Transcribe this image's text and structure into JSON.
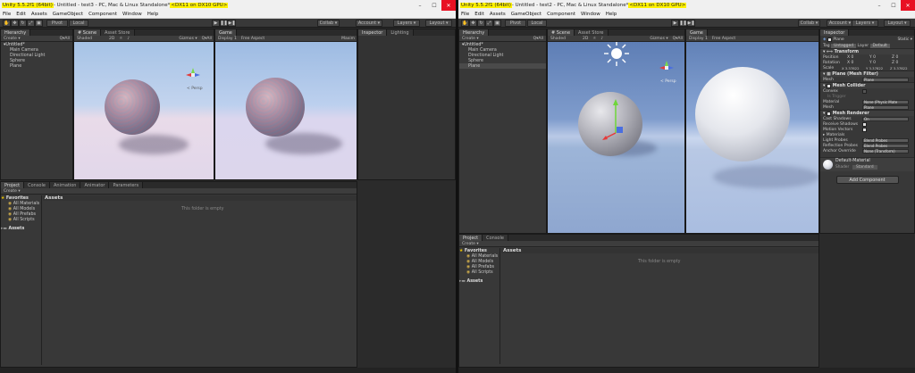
{
  "left": {
    "title_version": "Unity 5.5.2f1 (64bit)",
    "title_middle": " - Untitled - test3 - PC, Mac & Linux Standalone* ",
    "title_gpu": "<DX11 on DX10 GPU>",
    "menu": [
      "File",
      "Edit",
      "Assets",
      "GameObject",
      "Component",
      "Window",
      "Help"
    ],
    "toolbar": {
      "pivot": "Pivot",
      "local": "Local",
      "collab": "Collab ▾",
      "account": "Account ▾",
      "layers": "Layers ▾",
      "layout": "Layout ▾"
    },
    "hierarchy": {
      "tab": "Hierarchy",
      "create": "Create ▾",
      "search": "Q▾All",
      "root": "Untitled*",
      "items": [
        "Main Camera",
        "Directional Light",
        "Sphere",
        "Plane"
      ]
    },
    "scene": {
      "tab": "Scene",
      "tab2": "Asset Store",
      "shaded": "Shaded",
      "mode2d": "2D",
      "gizmos": "Gizmos ▾",
      "search": "Q▾All",
      "persp": "< Persp"
    },
    "game": {
      "tab": "Game",
      "display": "Display 1",
      "aspect": "Free Aspect",
      "maximize": "Maxim"
    },
    "inspector": {
      "tab": "Inspector",
      "tab2": "Lighting"
    },
    "project": {
      "tabs": [
        "Project",
        "Console",
        "Animation",
        "Animator",
        "Parameters"
      ],
      "create": "Create ▾",
      "favorites": "Favorites",
      "fav_items": [
        "All Materials",
        "All Models",
        "All Prefabs",
        "All Scripts"
      ],
      "assets": "Assets",
      "assets_header": "Assets",
      "empty": "This folder is empty"
    }
  },
  "right": {
    "title_version": "Unity 5.5.2f1 (64bit)",
    "title_middle": " - Untitled - test2 - PC, Mac & Linux Standalone* ",
    "title_gpu": "<DX11 on DX10 GPU>",
    "menu": [
      "File",
      "Edit",
      "Assets",
      "GameObject",
      "Component",
      "Window",
      "Help"
    ],
    "toolbar": {
      "pivot": "Pivot",
      "local": "Local",
      "collab": "Collab ▾",
      "account": "Account ▾",
      "layers": "Layers ▾",
      "layout": "Layout ▾"
    },
    "hierarchy": {
      "tab": "Hierarchy",
      "create": "Create ▾",
      "search": "Q▾All",
      "root": "Untitled*",
      "items": [
        "Main Camera",
        "Directional Light",
        "Sphere",
        "Plane"
      ],
      "selected": 3
    },
    "scene": {
      "tab": "Scene",
      "tab2": "Asset Store",
      "shaded": "Shaded",
      "mode2d": "2D",
      "gizmos": "Gizmos ▾",
      "search": "Q▾All",
      "persp": "< Persp"
    },
    "game": {
      "tab": "Game",
      "display": "Display 1",
      "aspect": "Free Aspect"
    },
    "project": {
      "tabs": [
        "Project",
        "Console"
      ],
      "create": "Create ▾",
      "favorites": "Favorites",
      "fav_items": [
        "All Materials",
        "All Models",
        "All Prefabs",
        "All Scripts"
      ],
      "assets": "Assets",
      "assets_header": "Assets",
      "empty": "This folder is empty"
    },
    "inspector": {
      "tab": "Inspector",
      "name": "Plane",
      "static": "Static ▾",
      "tag_label": "Tag",
      "tag": "Untagged",
      "layer_label": "Layer",
      "layer": "Default",
      "transform": {
        "title": "Transform",
        "position": "Position",
        "rotation": "Rotation",
        "scale": "Scale",
        "pos": [
          "X 0",
          "Y 0",
          "Z 0"
        ],
        "rot": [
          "X 0",
          "Y 0",
          "Z 0"
        ],
        "scl": [
          "X 3.37822",
          "Y 3.37822",
          "Z 3.37822"
        ]
      },
      "mesh_filter": {
        "title": "Plane (Mesh Filter)",
        "mesh_label": "Mesh",
        "mesh": "Plane"
      },
      "mesh_collider": {
        "title": "Mesh Collider",
        "convex": "Convex",
        "trigger": "Is Trigger",
        "material_label": "Material",
        "material": "None (Physic Mate",
        "mesh_label": "Mesh",
        "mesh": "Plane"
      },
      "mesh_renderer": {
        "title": "Mesh Renderer",
        "cast": "Cast Shadows",
        "cast_val": "On",
        "receive": "Receive Shadows",
        "motion": "Motion Vectors",
        "materials": "Materials",
        "light_probes": "Light Probes",
        "light_val": "Blend Probes",
        "refl_probes": "Reflection Probes",
        "refl_val": "Blend Probes",
        "anchor": "Anchor Override",
        "anchor_val": "None (Transform)"
      },
      "material": {
        "name": "Default-Material",
        "shader_label": "Shader",
        "shader": "Standard"
      },
      "add_component": "Add Component"
    }
  }
}
